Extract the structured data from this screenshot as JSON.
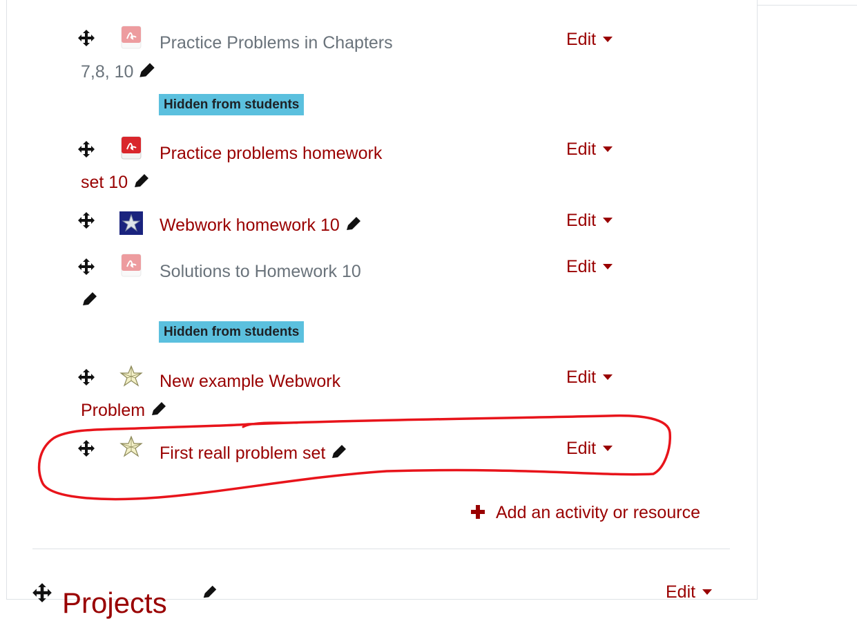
{
  "items": [
    {
      "title_line1": "Practice Problems in Chapters",
      "title_line2": "7,8, 10",
      "icon": "pdf-icon-dimmed",
      "edit_label": "Edit",
      "badge": "Hidden from students"
    },
    {
      "title_line1": "Practice problems homework",
      "title_line2": "set 10",
      "icon": "pdf-icon",
      "edit_label": "Edit"
    },
    {
      "title": "Webwork homework 10",
      "icon": "webwork-icon",
      "edit_label": "Edit"
    },
    {
      "title": "Solutions to Homework 10",
      "icon": "pdf-icon-dimmed",
      "edit_label": "Edit",
      "badge": "Hidden from students"
    },
    {
      "title_line1": "New example Webwork",
      "title_line2": "Problem",
      "icon": "webwork-star-icon",
      "edit_label": "Edit"
    },
    {
      "title": "First reall problem set",
      "icon": "webwork-star-icon",
      "edit_label": "Edit"
    }
  ],
  "add_activity_label": "Add an activity or resource",
  "next_section": {
    "title": "Projects",
    "edit_label": "Edit"
  },
  "colors": {
    "link": "#990000",
    "dimmed": "#6a737b",
    "badge": "#5bc0de",
    "annotation": "#e8141b"
  }
}
